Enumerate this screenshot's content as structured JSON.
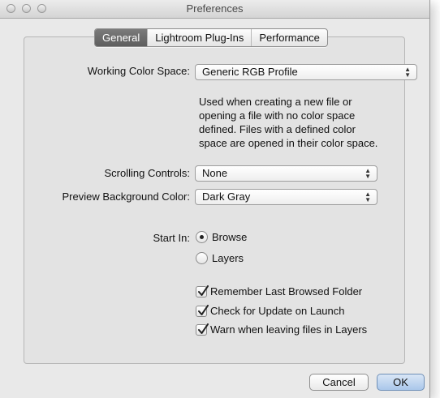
{
  "window": {
    "title": "Preferences"
  },
  "tabs": [
    {
      "label": "General",
      "active": true
    },
    {
      "label": "Lightroom Plug-Ins",
      "active": false
    },
    {
      "label": "Performance",
      "active": false
    }
  ],
  "working_color_space": {
    "label": "Working Color Space:",
    "value": "Generic RGB Profile",
    "description_lines": [
      "Used when creating a new file or",
      "opening a file with no color space",
      "defined. Files with a defined color",
      "space are opened in their color space."
    ]
  },
  "scrolling_controls": {
    "label": "Scrolling Controls:",
    "value": "None"
  },
  "preview_background": {
    "label": "Preview Background Color:",
    "value": "Dark Gray"
  },
  "start_in": {
    "label": "Start In:",
    "options": [
      {
        "label": "Browse",
        "selected": true
      },
      {
        "label": "Layers",
        "selected": false
      }
    ]
  },
  "checkboxes": [
    {
      "label": "Remember Last Browsed Folder",
      "checked": true
    },
    {
      "label": "Check for Update on Launch",
      "checked": true
    },
    {
      "label": "Warn when leaving files in Layers",
      "checked": true
    }
  ],
  "buttons": {
    "cancel": "Cancel",
    "ok": "OK"
  },
  "colors": {
    "active_tab": "#6b6b6b",
    "default_button": "#aac7ea",
    "window_bg": "#e9e9e9"
  },
  "icons": {
    "select_arrows": "updown-arrows-icon",
    "checkmark": "checkmark-icon"
  }
}
